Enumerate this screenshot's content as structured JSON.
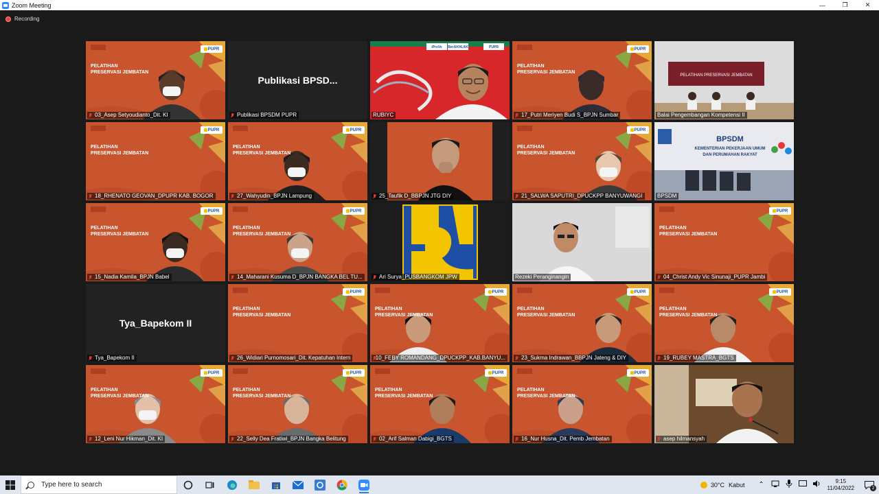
{
  "window": {
    "title": "Zoom Meeting",
    "controls": [
      "—",
      "❐",
      "✕"
    ]
  },
  "meeting": {
    "recording_label": "Recording"
  },
  "slide": {
    "title_line1": "PELATIHAN",
    "title_line2": "PRESERVASI JEMBATAN",
    "brand": "PUPR"
  },
  "tiles": [
    {
      "id": "t1",
      "name": "03_Asep Setyoudianto_Dit. KI",
      "kind": "slide",
      "muted": true
    },
    {
      "id": "t2",
      "name": "Publikasi BPSDM PUPR",
      "kind": "avatar",
      "big": "Publikasi BPSD...",
      "muted": true
    },
    {
      "id": "t3",
      "name": "RUBIYC",
      "kind": "camera",
      "muted": false,
      "active": true
    },
    {
      "id": "t4",
      "name": "17_Putri Meriyen Budi S_BPJN Sumbar",
      "kind": "slide",
      "muted": true
    },
    {
      "id": "t5",
      "name": "Balai Pengembangan Kompetensi II",
      "kind": "room",
      "muted": false
    },
    {
      "id": "t6",
      "name": "18_RHENATO GEOVAN_DPUPR KAB. BOGOR",
      "kind": "slide",
      "muted": true
    },
    {
      "id": "t7",
      "name": "27_Wahyudin_BPJN Lampung",
      "kind": "slide",
      "muted": true
    },
    {
      "id": "t8",
      "name": "25_Taufik D_BBPJN JTG DIY",
      "kind": "camera",
      "muted": true
    },
    {
      "id": "t9",
      "name": "21_SALWA SAPUTRI_DPUCKPP BANYUWANGI",
      "kind": "slide",
      "muted": true
    },
    {
      "id": "t10",
      "name": "BPSDM",
      "kind": "room",
      "muted": false
    },
    {
      "id": "t11",
      "name": "15_Nadia Kamila_BPJN Babel",
      "kind": "slide",
      "muted": true
    },
    {
      "id": "t12",
      "name": "14_Maharani Kusuma D_BPJN BANGKA BEL TU...",
      "kind": "slide",
      "muted": true
    },
    {
      "id": "t13",
      "name": "Ari Surya_PUSBANGKOM JPW",
      "kind": "logo",
      "muted": true
    },
    {
      "id": "t14",
      "name": "Rezeki Peranginangin",
      "kind": "camera",
      "muted": false
    },
    {
      "id": "t15",
      "name": "04_Christ Andy Vic Sinunaji_PUPR Jambi",
      "kind": "slide",
      "muted": true
    },
    {
      "id": "t16",
      "name": "Tya_Bapekom II",
      "kind": "avatar",
      "big": "Tya_Bapekom II",
      "muted": true
    },
    {
      "id": "t17",
      "name": "26_Widiari Purnomosari_Dit. Kepatuhan Intern",
      "kind": "slide",
      "muted": true
    },
    {
      "id": "t18",
      "name": "10_FEBY ROMANDANG_DPUCKPP_KAB.BANYU...",
      "kind": "slide",
      "muted": true
    },
    {
      "id": "t19",
      "name": "23_Sukma Indrawan_BBPJN Jateng & DIY",
      "kind": "slide",
      "muted": true
    },
    {
      "id": "t20",
      "name": "19_RUBEY MASTRA_BGTS",
      "kind": "slide",
      "muted": true
    },
    {
      "id": "t21",
      "name": "12_Leni Nur Hikman_Dit. KI",
      "kind": "slide",
      "muted": true
    },
    {
      "id": "t22",
      "name": "22_Selly Dea Fratiwi_BPJN Bangka Belitung",
      "kind": "slide",
      "muted": true
    },
    {
      "id": "t23",
      "name": "02_Arif Salman Dabigi_BGTS",
      "kind": "slide",
      "muted": true
    },
    {
      "id": "t24",
      "name": "16_Nur Husna_Dit. Pemb Jembatan",
      "kind": "slide",
      "muted": true
    },
    {
      "id": "t25",
      "name": "asep hilmansyah",
      "kind": "camera",
      "muted": true
    }
  ],
  "room_banners": {
    "t5": "PELATIHAN PRESERVASI JEMBATAN",
    "t10_line1": "BPSDM",
    "t10_line2": "KEMENTERIAN PEKERJAAN UMUM",
    "t10_line3": "DAN PERUMAHAN RAKYAT"
  },
  "t3_badges": [
    "iProVe",
    "BerAKHLAK",
    "PUPR"
  ],
  "taskbar": {
    "search_placeholder": "Type here to search",
    "apps": [
      "task-view",
      "edge",
      "file-explorer",
      "store",
      "mail",
      "outlook",
      "chrome",
      "zoom"
    ]
  },
  "tray": {
    "temperature": "30°C",
    "weather": "Kabut",
    "time": "9:15",
    "date": "11/04/2022",
    "notifications": "2"
  },
  "colors": {
    "slide_bg": "#c9552e",
    "active_border": "#f1dc3a",
    "muted_mic": "#e03b30",
    "zoom_blue": "#2d8cff"
  }
}
